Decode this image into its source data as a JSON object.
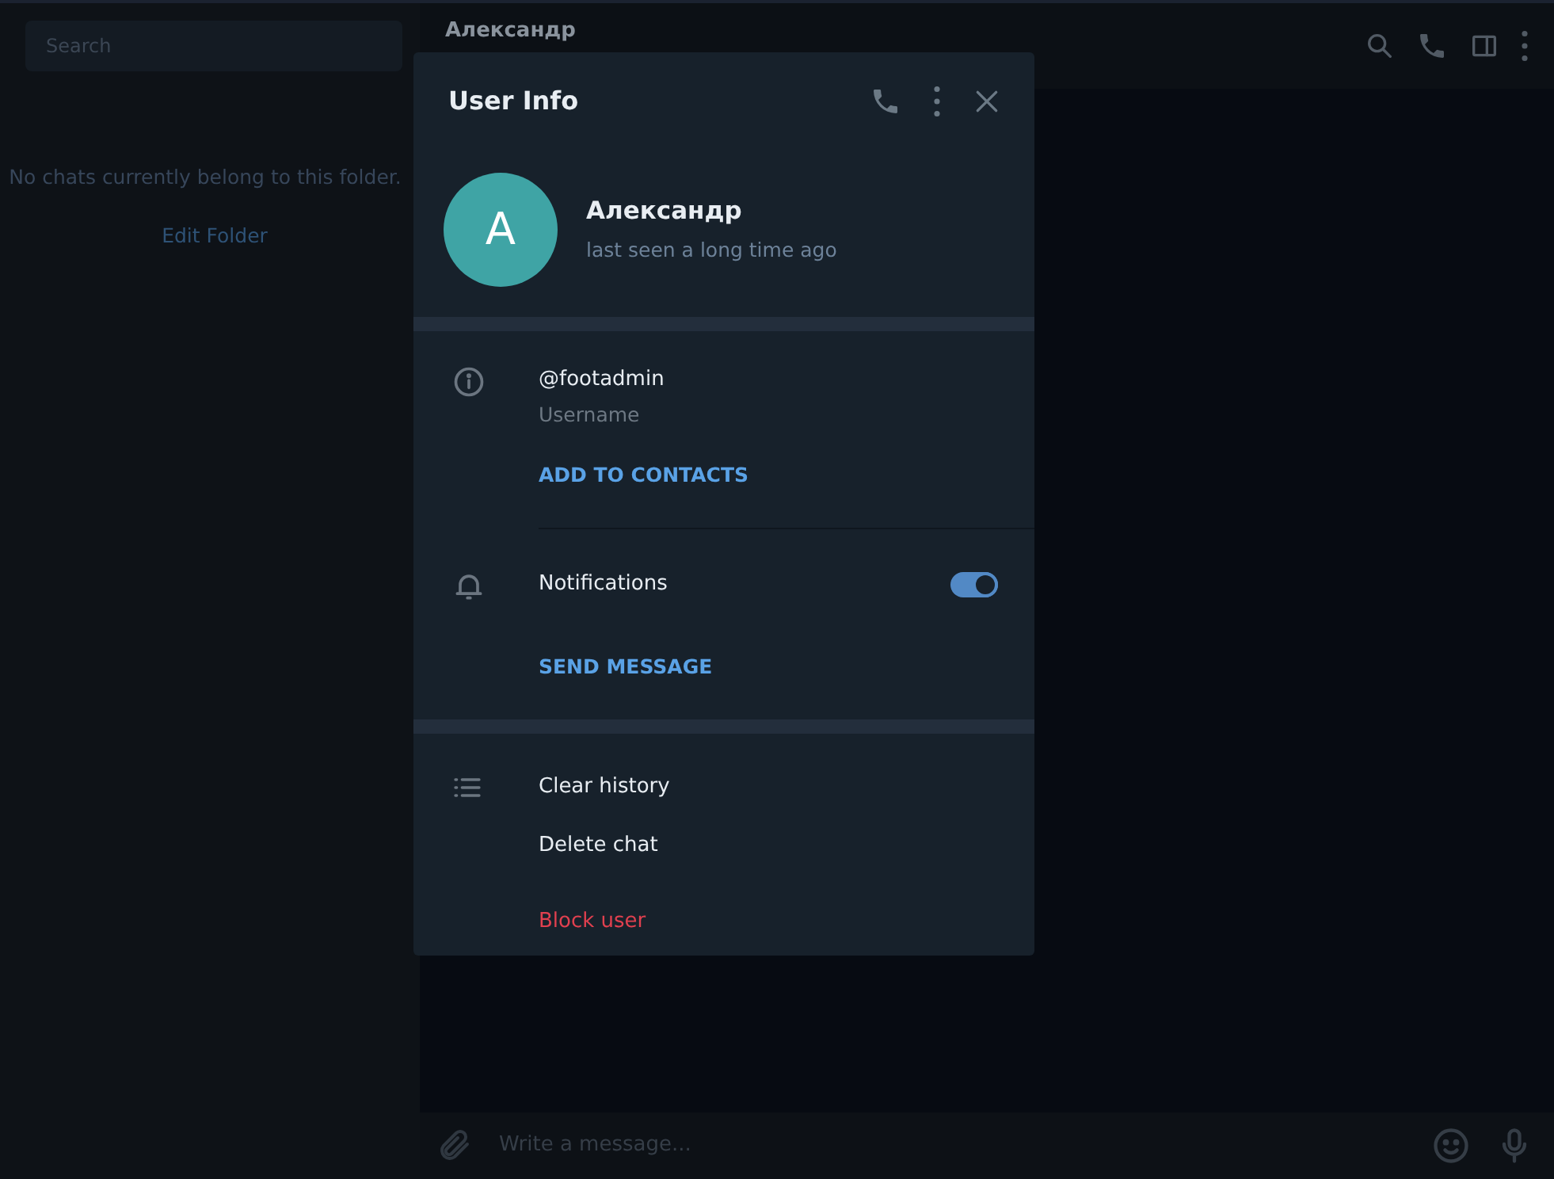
{
  "sidebar": {
    "search": {
      "placeholder": "Search"
    },
    "empty_text": "No chats currently belong to this folder.",
    "edit_link": "Edit Folder"
  },
  "chat": {
    "title": "Александр",
    "composer": {
      "placeholder": "Write a message..."
    }
  },
  "dialog": {
    "title": "User Info",
    "profile": {
      "avatar_letter": "A",
      "name": "Александр",
      "status": "last seen a long time ago"
    },
    "username": {
      "value": "@footadmin",
      "label": "Username"
    },
    "add_contact": "ADD TO CONTACTS",
    "notifications": {
      "label": "Notifications",
      "on": true
    },
    "send_message": "SEND MESSAGE",
    "actions": [
      {
        "label": "Clear history",
        "kind": "normal"
      },
      {
        "label": "Delete chat",
        "kind": "normal"
      },
      {
        "label": "Block user",
        "kind": "danger"
      }
    ]
  }
}
